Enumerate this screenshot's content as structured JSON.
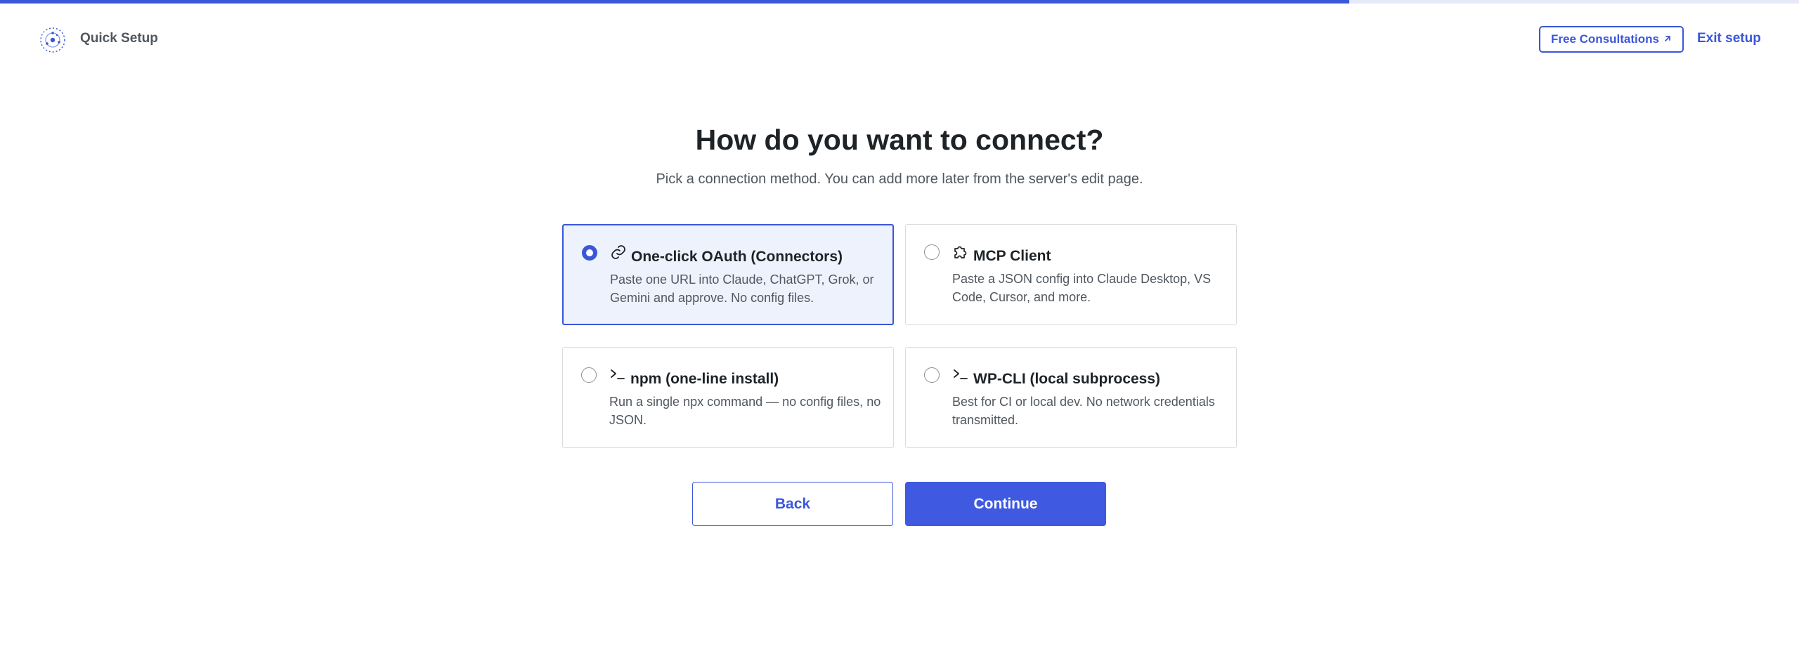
{
  "progress": {
    "fraction": 0.75
  },
  "header": {
    "app_title": "Quick Setup",
    "consult_label": "Free Consultations",
    "consult_icon": "external-arrow-icon",
    "exit_label": "Exit setup"
  },
  "main": {
    "heading": "How do you want to connect?",
    "subheading": "Pick a connection method. You can add more later from the server's edit page."
  },
  "options": [
    {
      "title": "One-click OAuth (Connectors)",
      "description": "Paste one URL into Claude, ChatGPT, Grok, or Gemini and approve. No config files.",
      "icon": "link-icon",
      "selected": true
    },
    {
      "title": "MCP Client",
      "description": "Paste a JSON config into Claude Desktop, VS Code, Cursor, and more.",
      "icon": "puzzle-icon",
      "selected": false
    },
    {
      "title": "npm (one-line install)",
      "description": "Run a single npx command — no config files, no JSON.",
      "icon": "terminal-icon",
      "selected": false
    },
    {
      "title": "WP-CLI (local subprocess)",
      "description": "Best for CI or local dev. No network credentials transmitted.",
      "icon": "terminal-icon",
      "selected": false
    }
  ],
  "actions": {
    "back_label": "Back",
    "continue_label": "Continue"
  },
  "colors": {
    "accent": "#3b57d9",
    "selected_bg": "#eef2fd"
  }
}
